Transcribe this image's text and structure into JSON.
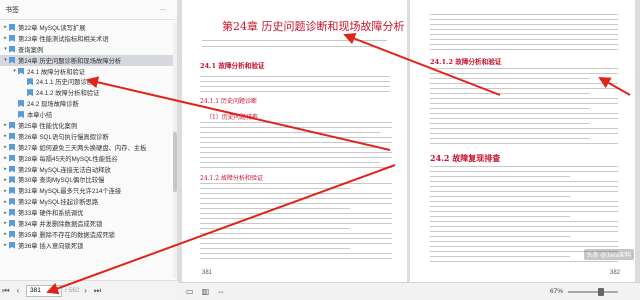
{
  "sidebar": {
    "title": "书签",
    "more": "...",
    "items": [
      {
        "label": "第22章 MySQL读写扩展",
        "level": 0,
        "toggle": "▸"
      },
      {
        "label": "第23章 性能测试指标和相关术语",
        "level": 0,
        "toggle": "▸"
      },
      {
        "label": "查询案例",
        "level": 0,
        "toggle": "▾"
      },
      {
        "label": "第24章 历史问题诊断和现场故障分析",
        "level": 0,
        "toggle": "▾",
        "selected": true
      },
      {
        "label": "24.1 故障分析和验证",
        "level": 1,
        "toggle": "▾"
      },
      {
        "label": "24.1.1 历史问题诊断",
        "level": 2,
        "toggle": ""
      },
      {
        "label": "24.1.2 故障分析和验证",
        "level": 2,
        "toggle": ""
      },
      {
        "label": "24.2 现场故障诊断",
        "level": 1,
        "toggle": ""
      },
      {
        "label": "本章小结",
        "level": 1,
        "toggle": ""
      },
      {
        "label": "第25章 性能优化案例",
        "level": 0,
        "toggle": "▸"
      },
      {
        "label": "第26章 SQL语句执行慢真假诊断",
        "level": 0,
        "toggle": "▸"
      },
      {
        "label": "第27章 如何避免三天两头换硬盘、内存、主板",
        "level": 0,
        "toggle": "▸"
      },
      {
        "label": "第28章 每隔45天的MySQL性能低谷",
        "level": 0,
        "toggle": "▸"
      },
      {
        "label": "第29章 MySQL连接无法自动释放",
        "level": 0,
        "toggle": "▸"
      },
      {
        "label": "第30章 查询MySQL偶尔比较慢",
        "level": 0,
        "toggle": "▸"
      },
      {
        "label": "第31章 MySQL最多只允许214个连接",
        "level": 0,
        "toggle": "▸"
      },
      {
        "label": "第32章 MySQL挂起诊断思路",
        "level": 0,
        "toggle": "▸"
      },
      {
        "label": "第33章 硬件和系统调优",
        "level": 0,
        "toggle": "▸"
      },
      {
        "label": "第34章 并发删除数据造成死锁",
        "level": 0,
        "toggle": "▸"
      },
      {
        "label": "第35章 删除不存在的数据造成死锁",
        "level": 0,
        "toggle": "▸"
      },
      {
        "label": "第36章 插入意向锁死锁",
        "level": 0,
        "toggle": "▸"
      }
    ],
    "page_current": "381",
    "page_total": "/ 562"
  },
  "document": {
    "chapter_title": "第24章 历史问题诊断和现场故障分析",
    "left_sections": [
      "24.1 故障分析和验证",
      "24.1.1 历史问题诊断",
      "（1）历史问题排查",
      "24.1.2 故障分析和验证"
    ],
    "right_sections": [
      "24.1.2 故障分析和验证",
      "24.2 故障复现排查"
    ],
    "left_page_num": "381",
    "right_page_num": "382"
  },
  "status": {
    "zoom": "67%",
    "watermark": "头条 @Java架构"
  },
  "colors": {
    "heading": "#c4122f",
    "arrow": "#e0231b",
    "selection": "#d5d9df"
  }
}
